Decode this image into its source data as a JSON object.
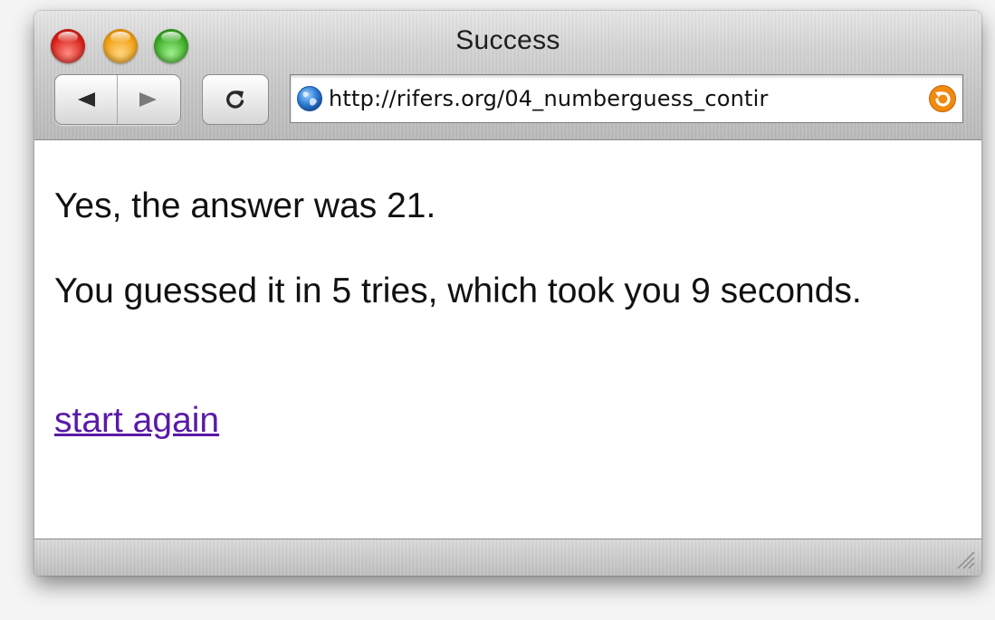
{
  "window": {
    "title": "Success"
  },
  "toolbar": {
    "back_icon": "back-arrow",
    "forward_icon": "forward-arrow",
    "reload_icon": "reload"
  },
  "address_bar": {
    "url": "http://rifers.org/04_numberguess_contir",
    "favicon": "globe-icon",
    "snapback_icon": "snapback-icon"
  },
  "page": {
    "answer_text": "Yes, the answer was 21.",
    "result_text": "You guessed it in 5 tries, which took you 9 seconds.",
    "start_again_link": "start again"
  },
  "colors": {
    "link": "#5a1aa8",
    "close": "#d8221a",
    "minimize": "#f0a012",
    "zoom": "#3dab27"
  }
}
